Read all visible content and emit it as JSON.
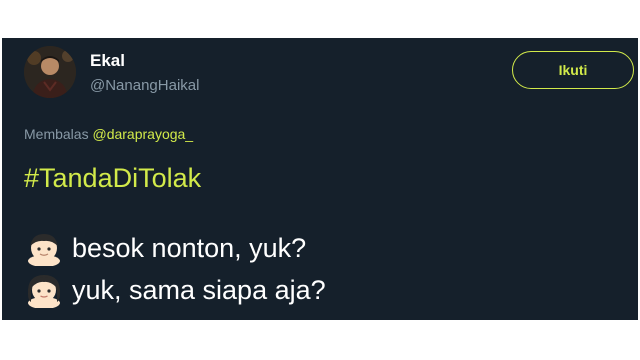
{
  "tweet": {
    "author": {
      "display_name": "Ekal",
      "handle": "@NanangHaikal"
    },
    "follow_button_label": "Ikuti",
    "reply": {
      "prefix": "Membalas",
      "mention": "@daraprayoga_"
    },
    "hashtag": "#TandaDiTolak",
    "lines": [
      {
        "emoji": "boy-face",
        "text": "besok nonton, yuk?"
      },
      {
        "emoji": "girl-face",
        "text": "yuk, sama siapa aja?"
      }
    ]
  },
  "colors": {
    "background": "#15202b",
    "accent": "#d2ea4a",
    "muted": "#8899a6",
    "text": "#ffffff"
  }
}
